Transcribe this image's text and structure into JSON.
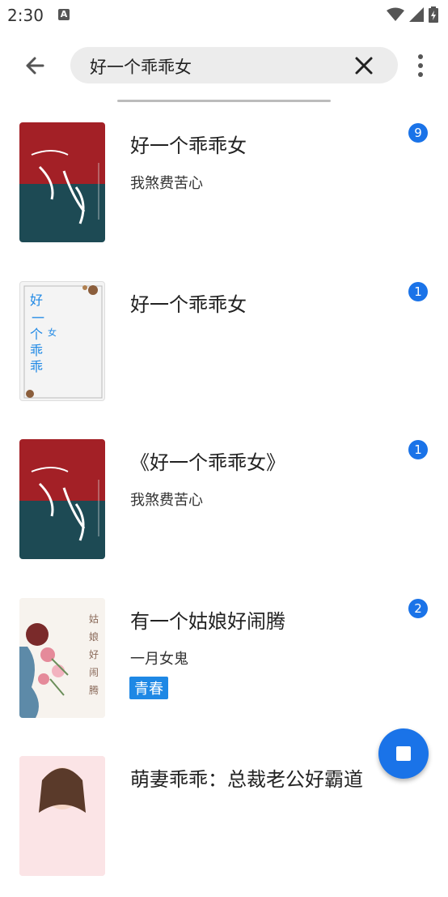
{
  "status_bar": {
    "time": "2:30",
    "notification_icon": "A",
    "icons": [
      "wifi-icon",
      "signal-icon",
      "battery-icon"
    ]
  },
  "search": {
    "query": "好一个乖乖女"
  },
  "results": [
    {
      "title": "好一个乖乖女",
      "author": "我煞费苦心",
      "tag": "",
      "count": "9",
      "cover": "red-teal"
    },
    {
      "title": "好一个乖乖女",
      "author": "",
      "tag": "",
      "count": "1",
      "cover": "white-frame"
    },
    {
      "title": "《好一个乖乖女》",
      "author": "我煞费苦心",
      "tag": "",
      "count": "1",
      "cover": "red-teal"
    },
    {
      "title": "有一个姑娘好闹腾",
      "author": "一月女鬼",
      "tag": "青春",
      "count": "2",
      "cover": "floral"
    },
    {
      "title": "萌妻乖乖：总裁老公好霸道",
      "author": "",
      "tag": "",
      "count": "",
      "cover": "pink-girl"
    }
  ],
  "colors": {
    "accent": "#1a73e8",
    "tag_bg": "#1e88e5",
    "search_bg": "#ececec"
  }
}
